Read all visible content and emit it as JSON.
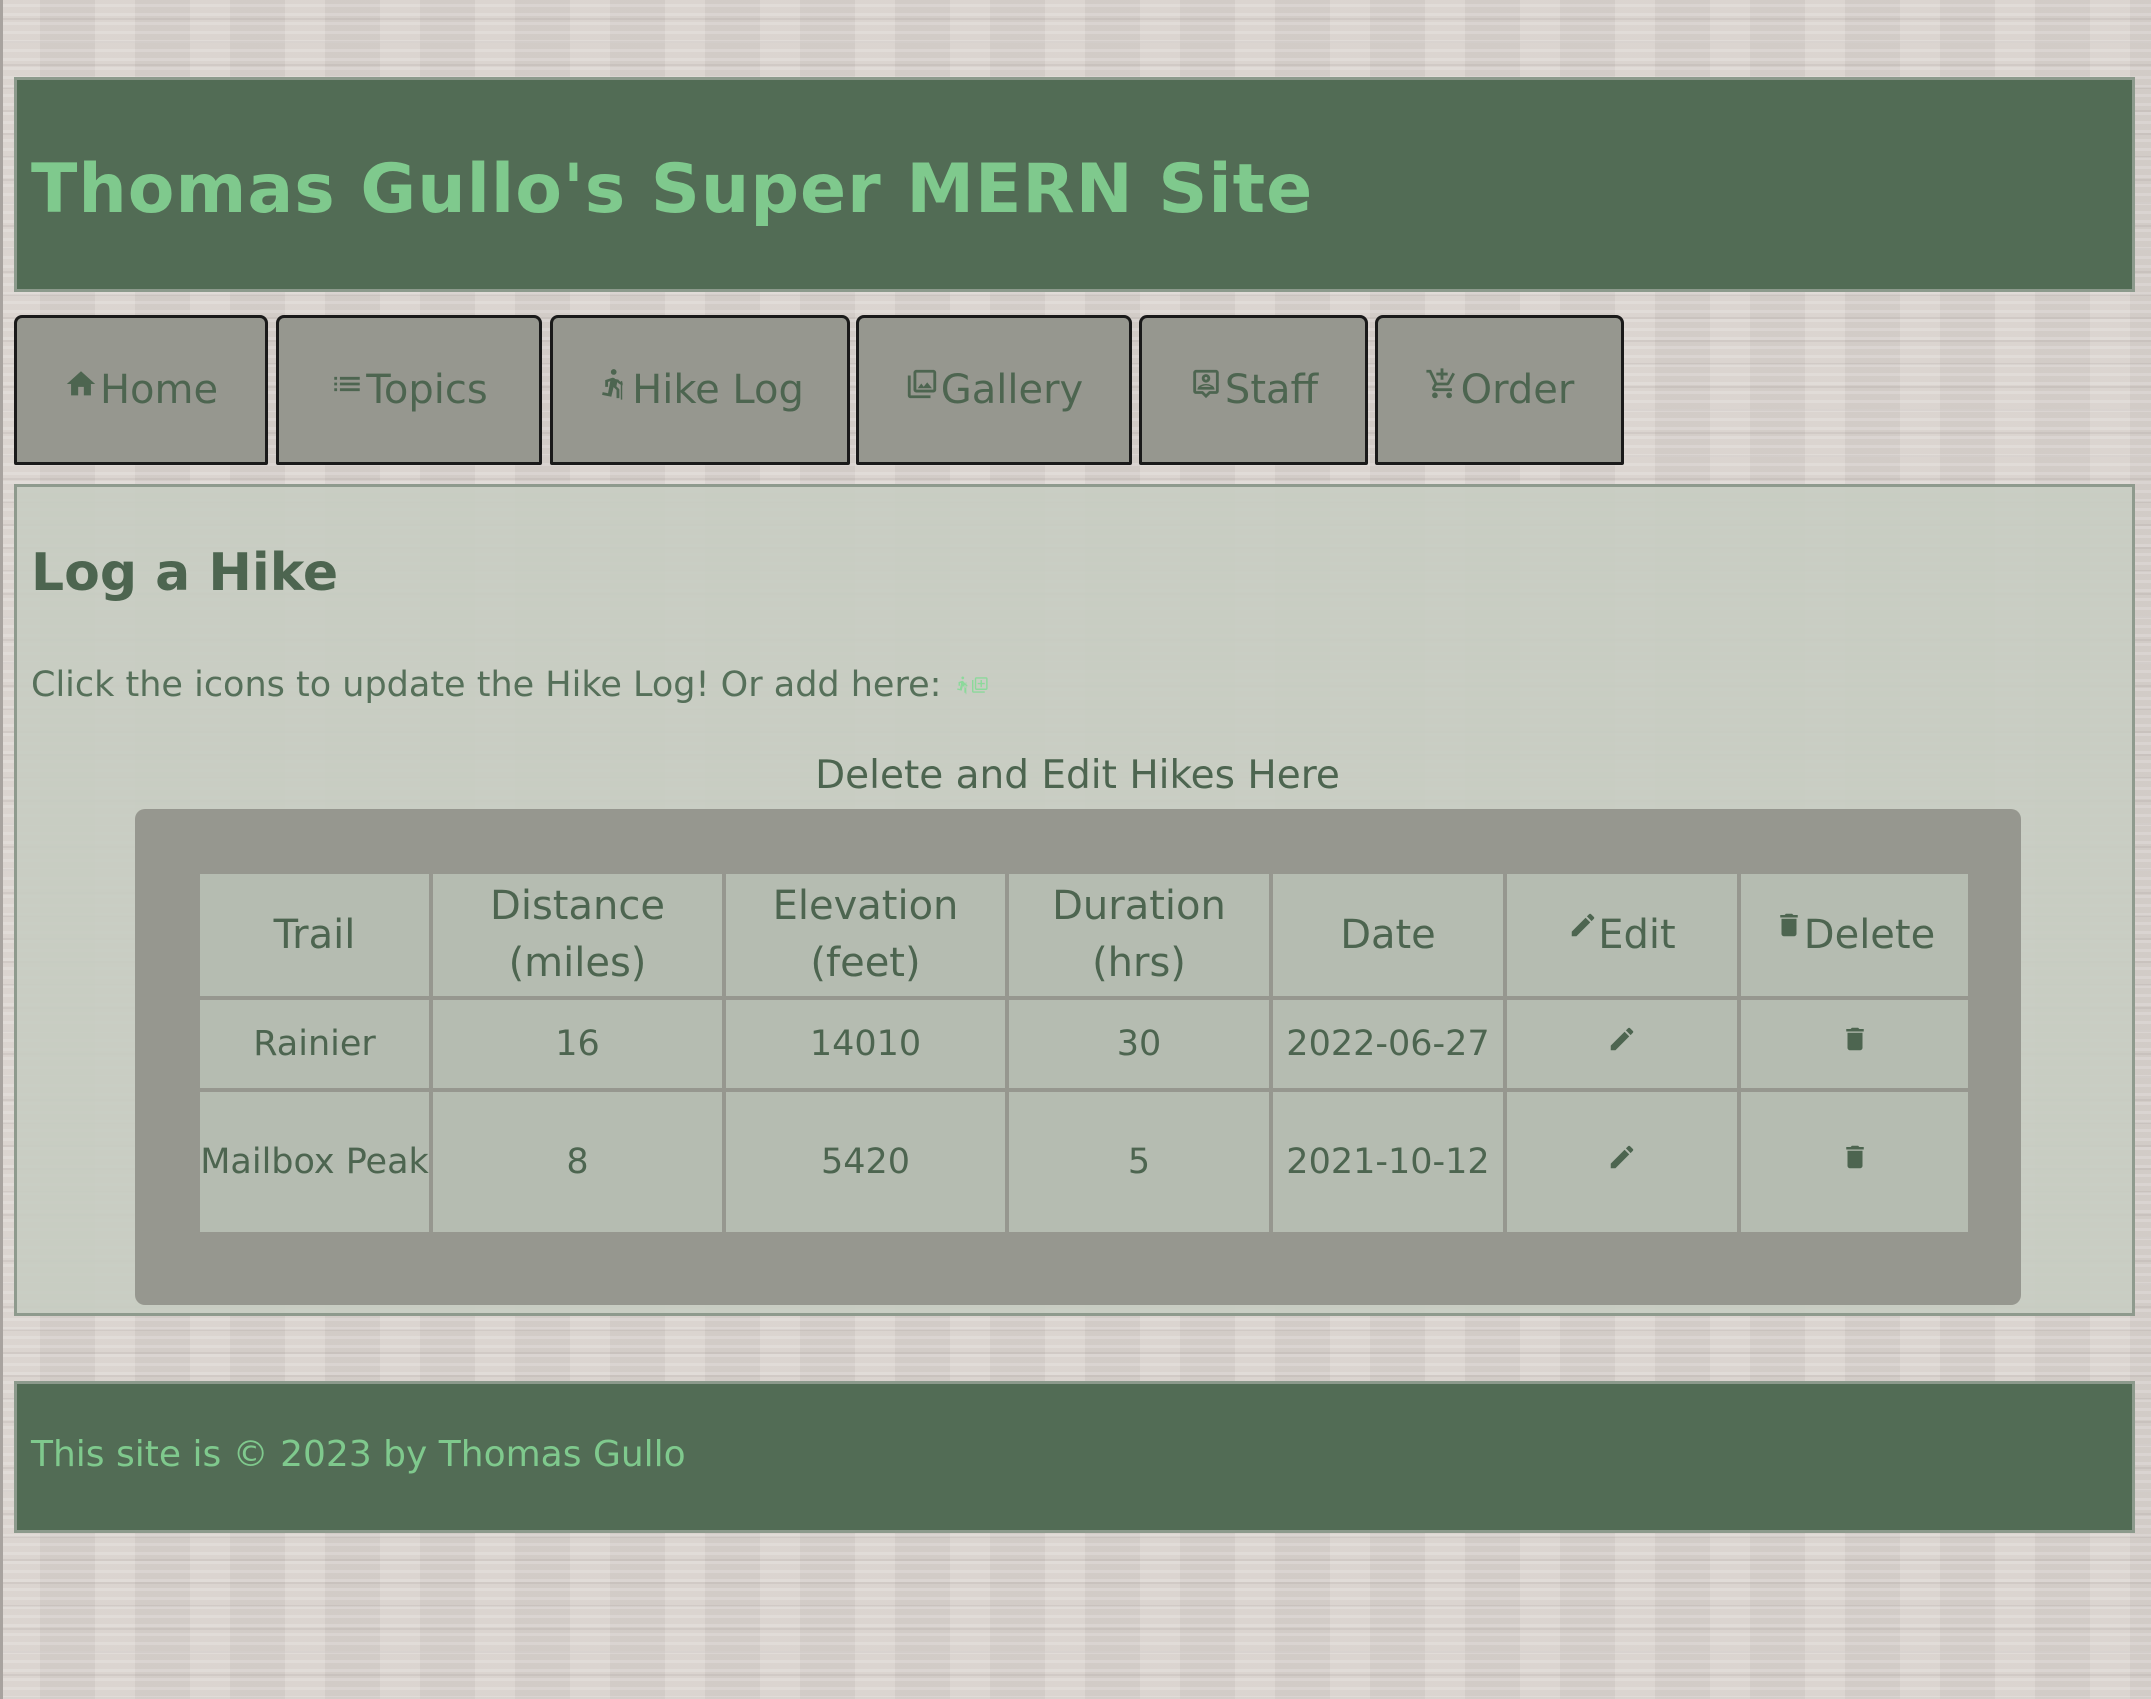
{
  "header": {
    "title": "Thomas Gullo's Super MERN Site"
  },
  "nav": {
    "items": [
      {
        "label": "Home",
        "icon": "home-icon"
      },
      {
        "label": "Topics",
        "icon": "list-icon"
      },
      {
        "label": "Hike Log",
        "icon": "hiker-icon"
      },
      {
        "label": "Gallery",
        "icon": "photo-library-icon"
      },
      {
        "label": "Staff",
        "icon": "badge-icon"
      },
      {
        "label": "Order",
        "icon": "cart-add-icon"
      }
    ]
  },
  "main": {
    "heading": "Log a Hike",
    "intro": "Click the icons to update the Hike Log! Or add here:",
    "add_icon": "hiker-add-icon",
    "table_caption": "Delete and Edit Hikes Here",
    "columns": {
      "trail": "Trail",
      "distance": "Distance (miles)",
      "elevation": "Elevation (feet)",
      "duration": "Duration (hrs)",
      "date": "Date",
      "edit": "Edit",
      "delete": "Delete"
    },
    "rows": [
      {
        "trail": "Rainier",
        "distance": "16",
        "elevation": "14010",
        "duration": "30",
        "date": "2022-06-27"
      },
      {
        "trail": "Mailbox Peak",
        "distance": "8",
        "elevation": "5420",
        "duration": "5",
        "date": "2021-10-12"
      }
    ]
  },
  "footer": {
    "text": "This site is © 2023 by Thomas Gullo"
  },
  "colors": {
    "header_bg": "#526c55",
    "header_text": "#7fc98d",
    "nav_bg": "#96978f",
    "text_green": "#4d6550",
    "accent_icon": "#8cd99b",
    "panel_bg": "#96978f",
    "cell_bg": "#b5bcb1"
  }
}
